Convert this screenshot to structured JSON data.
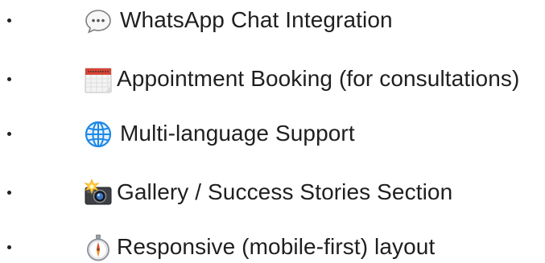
{
  "features": {
    "items": [
      {
        "label": "WhatsApp Chat Integration",
        "icon": "speech-bubble-icon"
      },
      {
        "label": "Appointment Booking (for consultations)",
        "icon": "calendar-icon"
      },
      {
        "label": "Multi-language Support",
        "icon": "globe-icon"
      },
      {
        "label": "Gallery / Success Stories Section",
        "icon": "camera-flash-icon"
      },
      {
        "label": "Responsive (mobile-first) layout",
        "icon": "compass-icon"
      }
    ]
  },
  "colors": {
    "text": "#1f1f1f",
    "bullet": "#222222",
    "globe": "#1e88e5",
    "calendar_red": "#d64535"
  }
}
